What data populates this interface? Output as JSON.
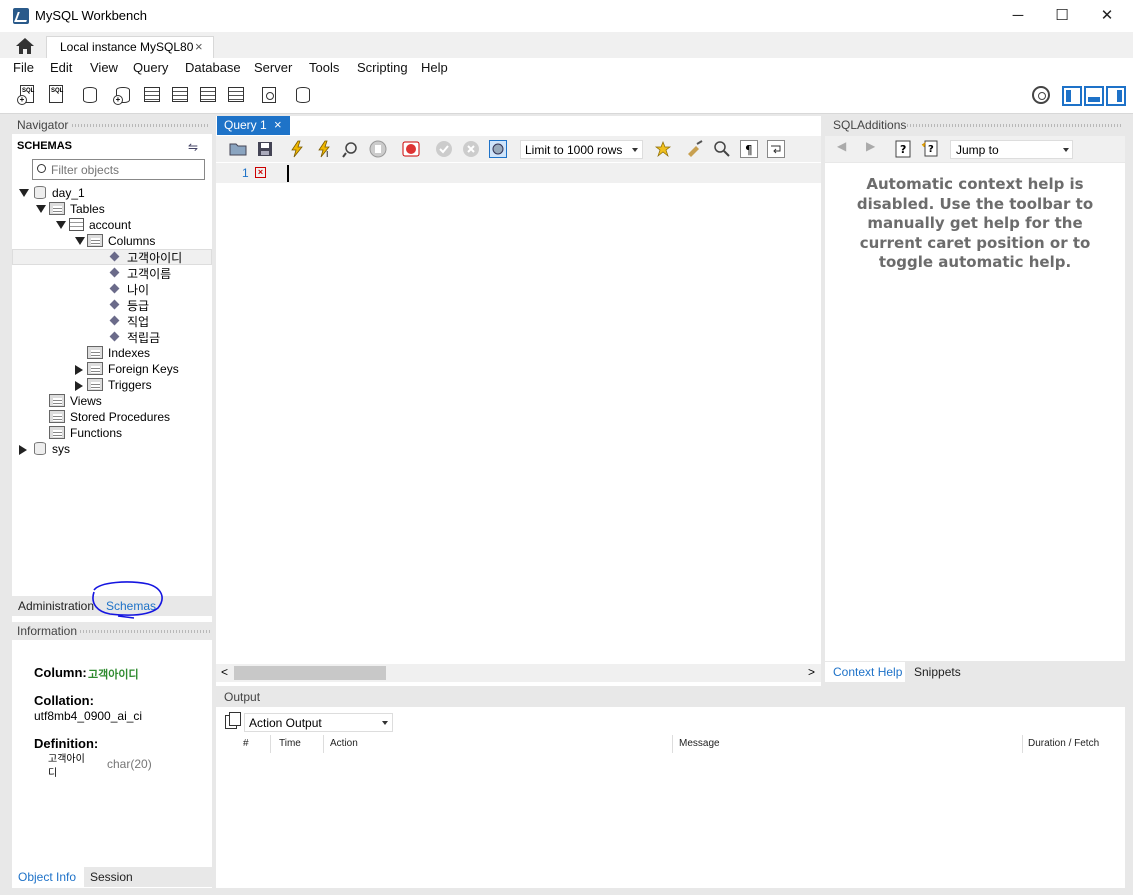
{
  "window": {
    "title": "MySQL Workbench",
    "controls": [
      "─",
      "☐",
      "✕"
    ]
  },
  "connection_tab": {
    "label": "Local instance MySQL80",
    "close": "×"
  },
  "menu": [
    "File",
    "Edit",
    "View",
    "Query",
    "Database",
    "Server",
    "Tools",
    "Scripting",
    "Help"
  ],
  "navigator": {
    "header": "Navigator",
    "schemas_title": "SCHEMAS",
    "filter_placeholder": "Filter objects",
    "tree": {
      "schema1": "day_1",
      "tables": "Tables",
      "table": "account",
      "columns_label": "Columns",
      "columns": [
        "고객아이디",
        "고객이름",
        "나이",
        "등급",
        "직업",
        "적립금"
      ],
      "indexes": "Indexes",
      "foreign_keys": "Foreign Keys",
      "triggers": "Triggers",
      "views": "Views",
      "stored_procedures": "Stored Procedures",
      "functions": "Functions",
      "schema2": "sys"
    },
    "bottom_tabs": [
      "Administration",
      "Schemas"
    ]
  },
  "information": {
    "header": "Information",
    "column_label": "Column:",
    "column_value": "고객아이디",
    "collation_label": "Collation:",
    "collation_value": "utf8mb4_0900_ai_ci",
    "definition_label": "Definition:",
    "def_name_line1": "고객아이",
    "def_name_line2": "디",
    "def_type": "char(20)",
    "tabs": [
      "Object Info",
      "Session"
    ]
  },
  "query": {
    "tab_label": "Query 1",
    "tab_close": "×",
    "limit_select": "Limit to 1000 rows",
    "line_number": "1",
    "error_marker": "×"
  },
  "sql_additions": {
    "header": "SQLAdditions",
    "jump_select": "Jump to",
    "help_text": "Automatic context help is disabled. Use the toolbar to manually get help for the current caret position or to toggle automatic help.",
    "tabs": [
      "Context Help",
      "Snippets"
    ]
  },
  "output": {
    "header": "Output",
    "select": "Action Output",
    "columns": [
      "#",
      "Time",
      "Action",
      "Message",
      "Duration / Fetch"
    ]
  },
  "colors": {
    "accent": "#1e73c8",
    "column_value_green": "#2e8b2e",
    "help_text_gray": "#6c6c6c",
    "annotation_blue": "#1515e0"
  }
}
